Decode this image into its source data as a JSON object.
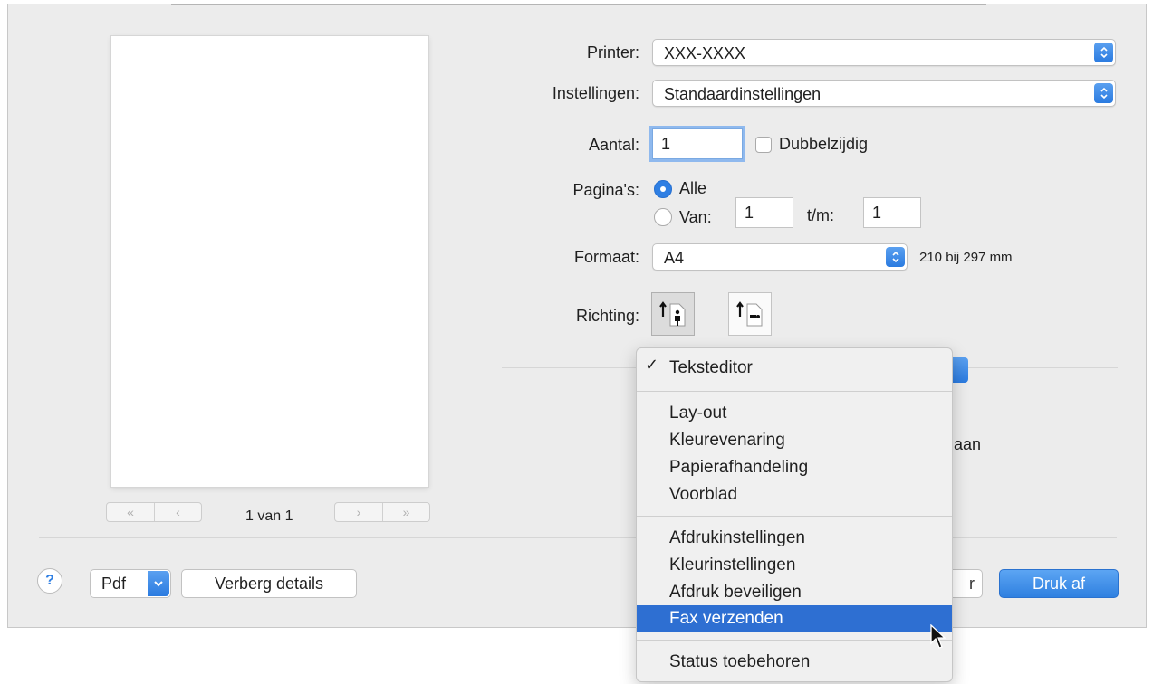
{
  "dialog": {
    "printer_label": "Printer:",
    "printer_value": "XXX-XXXX",
    "presets_label": "Instellingen:",
    "presets_value": "Standaardinstellingen",
    "copies_label": "Aantal:",
    "copies_value": "1",
    "duplex_label": "Dubbelzijdig",
    "pages_label": "Pagina's:",
    "pages_all": "Alle",
    "pages_from_label": "Van:",
    "pages_from_value": "1",
    "pages_to_label": "t/m:",
    "pages_to_value": "1",
    "format_label": "Formaat:",
    "format_value": "A4",
    "format_size": "210 bij 297 mm",
    "orientation_label": "Richting:",
    "partial_text": "aan"
  },
  "preview": {
    "page_indicator": "1 van 1",
    "first_label": "«",
    "prev_label": "‹",
    "next_label": "›",
    "last_label": "»"
  },
  "footer": {
    "help_label": "?",
    "pdf_label": "Pdf",
    "details_label": "Verberg details",
    "cancel_partial": "r",
    "print_label": "Druk af"
  },
  "menu": {
    "checked_item": "Teksteditor",
    "group1": [
      "Lay-out",
      "Kleurevenaring",
      "Papierafhandeling",
      "Voorblad"
    ],
    "group2": [
      "Afdrukinstellingen",
      "Kleurinstellingen",
      "Afdruk beveiligen",
      "Fax verzenden"
    ],
    "group3": [
      "Status toebehoren"
    ],
    "highlighted": "Fax verzenden"
  },
  "colors": {
    "accent": "#2f7fe3",
    "menu_highlight": "#2e6fd2",
    "dialog_bg": "#ececec"
  }
}
